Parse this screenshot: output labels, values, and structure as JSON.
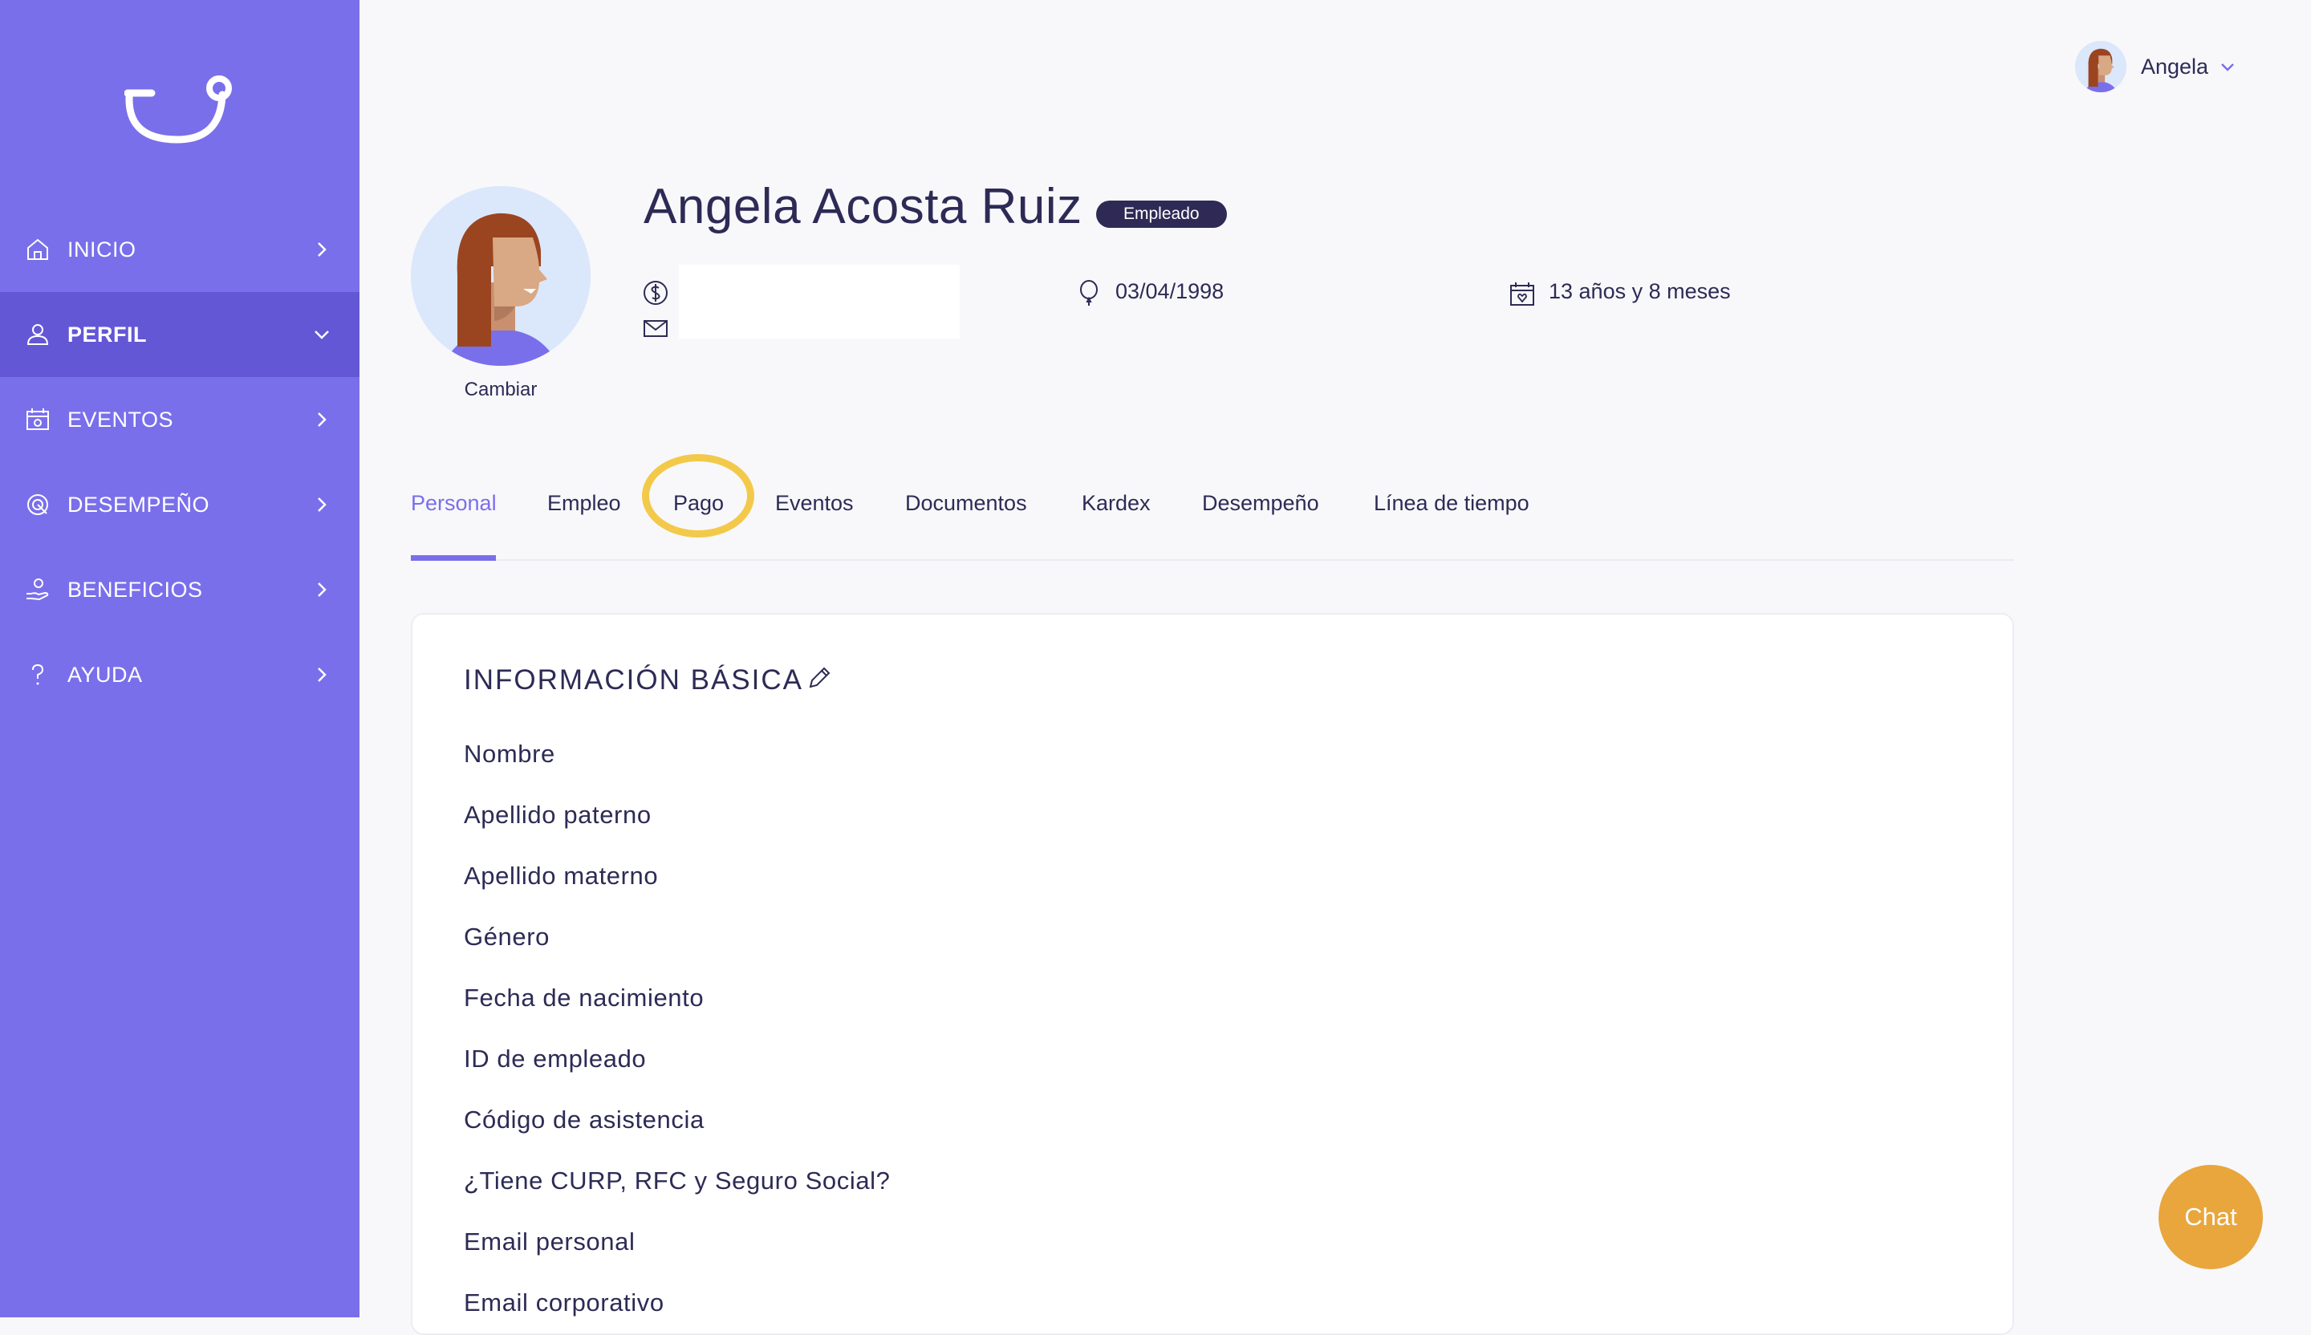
{
  "sidebar": {
    "items": [
      {
        "label": "INICIO",
        "icon": "home-icon"
      },
      {
        "label": "PERFIL",
        "icon": "user-icon",
        "active": true
      },
      {
        "label": "EVENTOS",
        "icon": "calendar-icon"
      },
      {
        "label": "DESEMPEÑO",
        "icon": "target-icon"
      },
      {
        "label": "BENEFICIOS",
        "icon": "hand-coin-icon"
      },
      {
        "label": "AYUDA",
        "icon": "question-icon"
      }
    ]
  },
  "user_menu": {
    "name": "Angela"
  },
  "profile": {
    "name": "Angela Acosta Ruiz",
    "badge": "Empleado",
    "change_label": "Cambiar",
    "birthdate": "03/04/1998",
    "seniority": "13 años y 8 meses"
  },
  "tabs": [
    {
      "label": "Personal",
      "active": true
    },
    {
      "label": "Empleo"
    },
    {
      "label": "Pago"
    },
    {
      "label": "Eventos"
    },
    {
      "label": "Documentos"
    },
    {
      "label": "Kardex"
    },
    {
      "label": "Desempeño"
    },
    {
      "label": "Línea de tiempo"
    }
  ],
  "basic_info": {
    "title": "INFORMACIÓN BÁSICA",
    "fields": [
      "Nombre",
      "Apellido paterno",
      "Apellido materno",
      "Género",
      "Fecha de nacimiento",
      "ID de empleado",
      "Código de asistencia",
      "¿Tiene CURP, RFC y Seguro Social?",
      "Email personal",
      "Email corporativo"
    ]
  },
  "chat": {
    "label": "Chat"
  },
  "colors": {
    "sidebar": "#7a6fea",
    "sidebar_active": "#6457d6",
    "accent": "#7a6fea",
    "highlight": "#f3c94a",
    "chat": "#e8a63d",
    "badge": "#2e2a55"
  }
}
